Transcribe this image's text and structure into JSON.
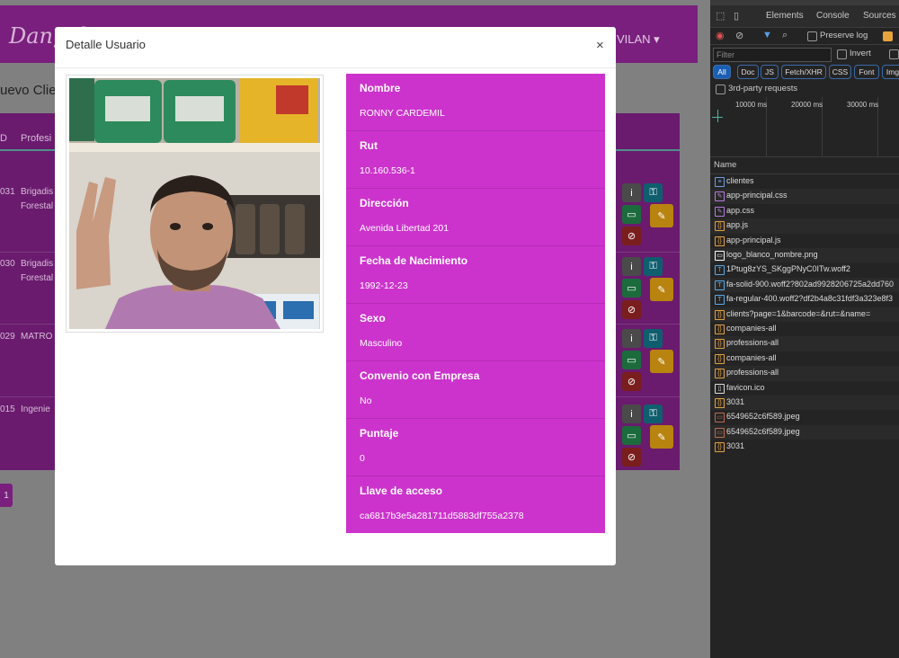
{
  "app": {
    "brand": "Dangel",
    "user_menu": "VILAN ▾",
    "page_title": "uevo Clien",
    "table": {
      "headers": [
        "D",
        "Profesi"
      ],
      "rows": [
        {
          "id": "031",
          "profession": "Brigadis\nForestal"
        },
        {
          "id": "030",
          "profession": "Brigadis\nForestal"
        },
        {
          "id": "029",
          "profession": "MATRO"
        },
        {
          "id": "015",
          "profession": "Ingenie"
        }
      ]
    },
    "pager": "1"
  },
  "modal": {
    "title": "Detalle Usuario",
    "close": "×",
    "fields": [
      {
        "label": "Nombre",
        "value": "RONNY CARDEMIL"
      },
      {
        "label": "Rut",
        "value": "10.160.536-1"
      },
      {
        "label": "Dirección",
        "value": "Avenida Libertad 201"
      },
      {
        "label": "Fecha de Nacimiento",
        "value": "1992-12-23"
      },
      {
        "label": "Sexo",
        "value": "Masculino"
      },
      {
        "label": "Convenio con Empresa",
        "value": "No"
      },
      {
        "label": "Puntaje",
        "value": "0"
      },
      {
        "label": "Llave de acceso",
        "value": "ca6817b3e5a281711d5883df755a2378"
      }
    ],
    "photo_icon": "user-photo"
  },
  "devtools": {
    "tabs": [
      "Elements",
      "Console",
      "Sources"
    ],
    "preserve_log": "Preserve log",
    "filter_placeholder": "Filter",
    "invert": "Invert",
    "type_filters": [
      "All",
      "Doc",
      "JS",
      "Fetch/XHR",
      "CSS",
      "Font",
      "Img"
    ],
    "third_party": "3rd-party requests",
    "timeline_labels": [
      "10000 ms",
      "20000 ms",
      "30000 ms"
    ],
    "name_header": "Name",
    "requests": [
      {
        "name": "clientes",
        "type": "doc",
        "color": "#6d9ee8"
      },
      {
        "name": "app-principal.css",
        "type": "css",
        "color": "#b57edc"
      },
      {
        "name": "app.css",
        "type": "css",
        "color": "#b57edc"
      },
      {
        "name": "app.js",
        "type": "js",
        "color": "#e6a23c"
      },
      {
        "name": "app-principal.js",
        "type": "js",
        "color": "#e6a23c"
      },
      {
        "name": "logo_blanco_nombre.png",
        "type": "img",
        "color": "#ffffff"
      },
      {
        "name": "1Ptug8zYS_SKggPNyC0ITw.woff2",
        "type": "font",
        "color": "#5aa9e6"
      },
      {
        "name": "fa-solid-900.woff2?802ad9928206725a2dd760",
        "type": "font",
        "color": "#5aa9e6"
      },
      {
        "name": "fa-regular-400.woff2?df2b4a8c31fdf3a323e8f3",
        "type": "font",
        "color": "#5aa9e6"
      },
      {
        "name": "clients?page=1&barcode=&rut=&name=",
        "type": "xhr",
        "color": "#e6a23c"
      },
      {
        "name": "companies-all",
        "type": "xhr",
        "color": "#e6a23c"
      },
      {
        "name": "professions-all",
        "type": "xhr",
        "color": "#e6a23c"
      },
      {
        "name": "companies-all",
        "type": "xhr",
        "color": "#e6a23c"
      },
      {
        "name": "professions-all",
        "type": "xhr",
        "color": "#e6a23c"
      },
      {
        "name": "favicon.ico",
        "type": "other",
        "color": "#dddddd"
      },
      {
        "name": "3031",
        "type": "xhr",
        "color": "#e6a23c"
      },
      {
        "name": "6549652c6f589.jpeg",
        "type": "img",
        "color": "#c06a4a"
      },
      {
        "name": "6549652c6f589.jpeg",
        "type": "img",
        "color": "#c06a4a"
      },
      {
        "name": "3031",
        "type": "xhr",
        "color": "#e6a23c"
      }
    ]
  },
  "colors": {
    "details_bg": "#cc33cc",
    "navbar": "#7a1f7e",
    "devtools_bg": "#242424"
  }
}
